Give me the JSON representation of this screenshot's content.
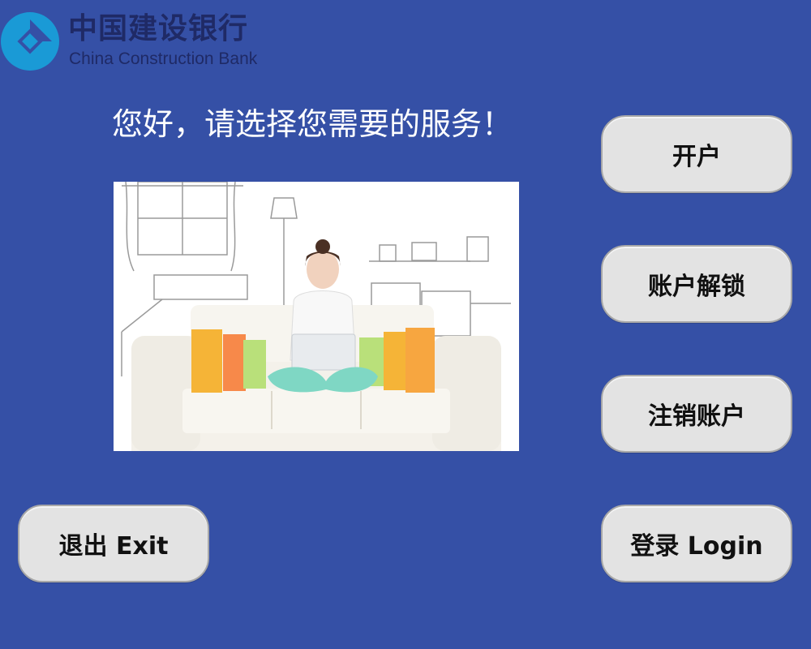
{
  "brand": {
    "name_cn": "中国建设银行",
    "name_en": "China Construction Bank",
    "logo_icon": "ccb-logo-icon",
    "logo_color": "#1a9ad6",
    "text_color": "#1f2a66"
  },
  "greeting": "您好，请选择您需要的服务！",
  "hero_image": {
    "icon": "woman-on-sofa-shopping-photo"
  },
  "buttons": {
    "open_account": "开户",
    "unlock_account": "账户解锁",
    "close_account": "注销账户",
    "login": "登录 Login",
    "exit": "退出 Exit"
  },
  "colors": {
    "background": "#3550a6",
    "button_bg": "#e3e3e3",
    "button_text": "#111111",
    "greeting_text": "#ffffff"
  }
}
